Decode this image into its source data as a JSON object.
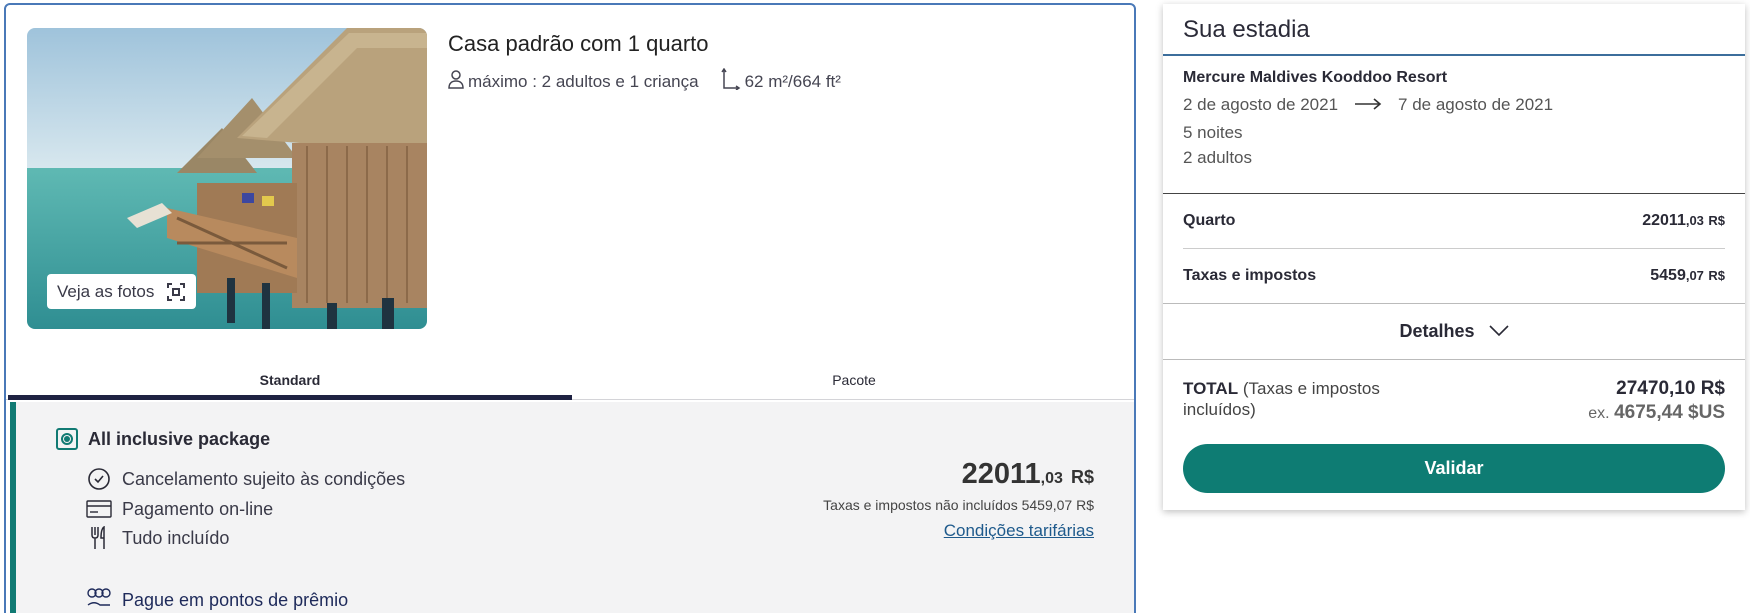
{
  "room": {
    "title": "Casa padrão com 1 quarto",
    "capacity": "máximo : 2 adultos e 1 criança",
    "size": "62 m²/664 ft²",
    "photos_label": "Veja as fotos"
  },
  "tabs": [
    {
      "label": "Standard",
      "active": true
    },
    {
      "label": "Pacote",
      "active": false
    }
  ],
  "rate": {
    "package_name": "All inclusive package",
    "features": [
      {
        "icon": "clock-icon",
        "label": "Cancelamento sujeito às condições"
      },
      {
        "icon": "credit-card-icon",
        "label": "Pagamento on-line"
      },
      {
        "icon": "fork-knife-icon",
        "label": "Tudo incluído"
      }
    ],
    "points_label": "Pague em pontos de prêmio",
    "price_main": "22011",
    "price_cents": ",03",
    "price_currency": "R$",
    "tax_note": "Taxas e impostos não incluídos 5459,07 R$",
    "conditions_link": "Condições tarifárias"
  },
  "summary": {
    "title": "Sua estadia",
    "hotel_name": "Mercure Maldives Kooddoo Resort",
    "checkin": "2 de agosto de 2021",
    "checkout": "7 de agosto de 2021",
    "nights": "5 noites",
    "guests": "2 adultos",
    "room_label": "Quarto",
    "room_main": "22011",
    "room_cents": ",03",
    "room_currency": "R$",
    "tax_label": "Taxas e impostos",
    "tax_main": "5459",
    "tax_cents": ",07",
    "tax_currency": "R$",
    "details_label": "Detalhes",
    "total_label": "TOTAL",
    "total_sub": "(Taxas e impostos incluídos)",
    "total_value": "27470,10 R$",
    "usd_prefix": "ex.",
    "usd_value": "4675,44 $US",
    "validate_label": "Validar"
  },
  "colors": {
    "accent_teal": "#0e7c73",
    "navy": "#1f2242",
    "card_border": "#4a79b8",
    "link": "#1e5a8c"
  }
}
